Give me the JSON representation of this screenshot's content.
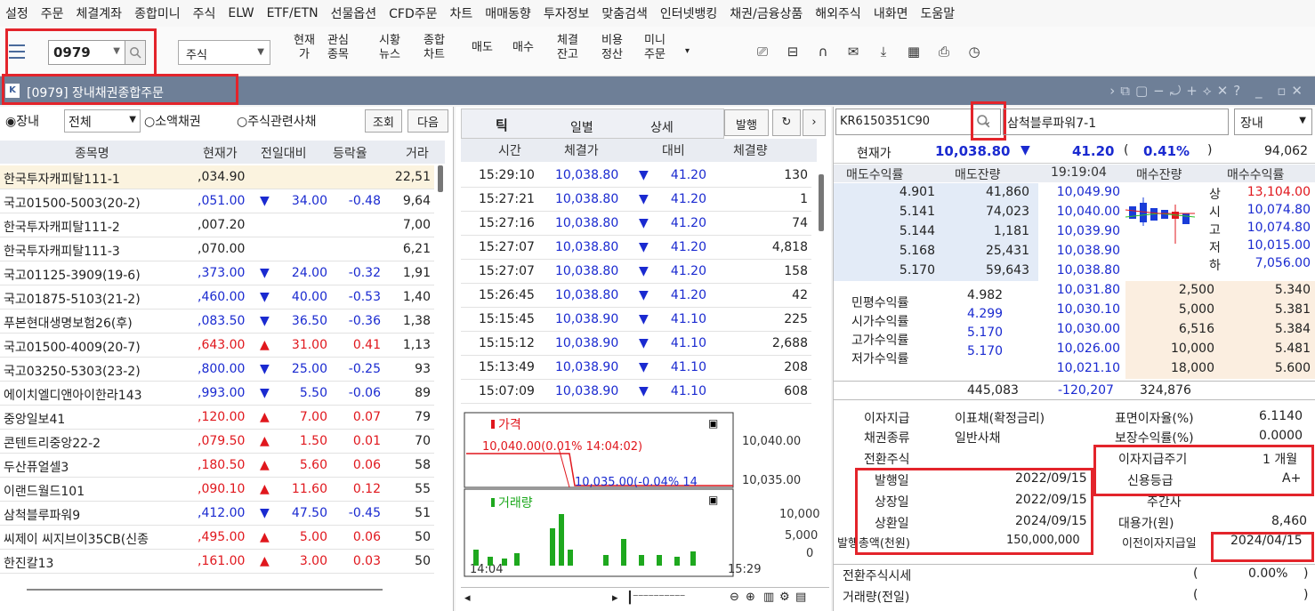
{
  "menu": [
    "설정",
    "주문",
    "체결계좌",
    "종합미니",
    "주식",
    "ELW",
    "ETF/ETN",
    "선물옵션",
    "CFD주문",
    "차트",
    "매매동향",
    "투자정보",
    "맞춤검색",
    "인터넷뱅킹",
    "채권/금융상품",
    "해외주식",
    "내화면",
    "도움말"
  ],
  "toolbar": {
    "code": "0979",
    "market_select": "주식",
    "buttons": [
      "현재\n가",
      "관심\n종목",
      "시황\n뉴스",
      "종합\n차트",
      "매도",
      "매수",
      "체결\n잔고",
      "비용\n정산",
      "미니\n주문"
    ],
    "icons": [
      "monitor-icon",
      "screen-icon",
      "headset-icon",
      "mail-icon",
      "download-icon",
      "calculator-icon",
      "print-icon",
      "clock-icon"
    ]
  },
  "window": {
    "title": "[0979] 장내채권종합주문"
  },
  "left": {
    "radio_listed": "장내",
    "filter": "전체",
    "radio_small": "소액채권",
    "radio_equity": "주식관련사채",
    "btn_query": "조회",
    "btn_next": "다음",
    "headers": [
      "종목명",
      "현재가",
      "전일대비",
      "등락율",
      "거라"
    ],
    "rows": [
      {
        "name": "한국투자캐피탈111-1",
        "price": ",034.90",
        "arrow": "",
        "change": "",
        "rate": "",
        "vol": "22,51",
        "dir": ""
      },
      {
        "name": "국고01500-5003(20-2)",
        "price": ",051.00",
        "arrow": "▼",
        "change": "34.00",
        "rate": "-0.48",
        "vol": "9,64",
        "dir": "down"
      },
      {
        "name": "한국투자캐피탈111-2",
        "price": ",007.20",
        "arrow": "",
        "change": "",
        "rate": "",
        "vol": "7,00",
        "dir": ""
      },
      {
        "name": "한국투자캐피탈111-3",
        "price": ",070.00",
        "arrow": "",
        "change": "",
        "rate": "",
        "vol": "6,21",
        "dir": ""
      },
      {
        "name": "국고01125-3909(19-6)",
        "price": ",373.00",
        "arrow": "▼",
        "change": "24.00",
        "rate": "-0.32",
        "vol": "1,91",
        "dir": "down"
      },
      {
        "name": "국고01875-5103(21-2)",
        "price": ",460.00",
        "arrow": "▼",
        "change": "40.00",
        "rate": "-0.53",
        "vol": "1,40",
        "dir": "down"
      },
      {
        "name": "푸본현대생명보험26(후)",
        "price": ",083.50",
        "arrow": "▼",
        "change": "36.50",
        "rate": "-0.36",
        "vol": "1,38",
        "dir": "down"
      },
      {
        "name": "국고01500-4009(20-7)",
        "price": ",643.00",
        "arrow": "▲",
        "change": "31.00",
        "rate": "0.41",
        "vol": "1,13",
        "dir": "up"
      },
      {
        "name": "국고03250-5303(23-2)",
        "price": ",800.00",
        "arrow": "▼",
        "change": "25.00",
        "rate": "-0.25",
        "vol": "93",
        "dir": "down"
      },
      {
        "name": "에이치엘디앤아이한라143",
        "price": ",993.00",
        "arrow": "▼",
        "change": "5.50",
        "rate": "-0.06",
        "vol": "89",
        "dir": "down"
      },
      {
        "name": "중앙일보41",
        "price": ",120.00",
        "arrow": "▲",
        "change": "7.00",
        "rate": "0.07",
        "vol": "79",
        "dir": "up"
      },
      {
        "name": "콘텐트리중앙22-2",
        "price": ",079.50",
        "arrow": "▲",
        "change": "1.50",
        "rate": "0.01",
        "vol": "70",
        "dir": "up"
      },
      {
        "name": "두산퓨얼셀3",
        "price": ",180.50",
        "arrow": "▲",
        "change": "5.60",
        "rate": "0.06",
        "vol": "58",
        "dir": "up"
      },
      {
        "name": "이랜드월드101",
        "price": ",090.10",
        "arrow": "▲",
        "change": "11.60",
        "rate": "0.12",
        "vol": "55",
        "dir": "up"
      },
      {
        "name": "삼척블루파워9",
        "price": ",412.00",
        "arrow": "▼",
        "change": "47.50",
        "rate": "-0.45",
        "vol": "51",
        "dir": "down"
      },
      {
        "name": "씨제이 씨지브이35CB(신종",
        "price": ",495.00",
        "arrow": "▲",
        "change": "5.00",
        "rate": "0.06",
        "vol": "50",
        "dir": "up"
      },
      {
        "name": "한진칼13",
        "price": ",161.00",
        "arrow": "▲",
        "change": "3.00",
        "rate": "0.03",
        "vol": "50",
        "dir": "up"
      }
    ]
  },
  "middle": {
    "tabs": [
      "틱",
      "일별",
      "상세"
    ],
    "btn_issue": "발행",
    "headers": [
      "시간",
      "체결가",
      "대비",
      "체결량"
    ],
    "rows": [
      {
        "time": "15:29:10",
        "price": "10,038.80",
        "change": "41.20",
        "qty": "130"
      },
      {
        "time": "15:27:21",
        "price": "10,038.80",
        "change": "41.20",
        "qty": "1"
      },
      {
        "time": "15:27:16",
        "price": "10,038.80",
        "change": "41.20",
        "qty": "74"
      },
      {
        "time": "15:27:07",
        "price": "10,038.80",
        "change": "41.20",
        "qty": "4,818"
      },
      {
        "time": "15:27:07",
        "price": "10,038.80",
        "change": "41.20",
        "qty": "158"
      },
      {
        "time": "15:26:45",
        "price": "10,038.80",
        "change": "41.20",
        "qty": "42"
      },
      {
        "time": "15:15:45",
        "price": "10,038.90",
        "change": "41.10",
        "qty": "225"
      },
      {
        "time": "15:15:12",
        "price": "10,038.90",
        "change": "41.10",
        "qty": "2,688"
      },
      {
        "time": "15:13:49",
        "price": "10,038.90",
        "change": "41.10",
        "qty": "208"
      },
      {
        "time": "15:07:09",
        "price": "10,038.90",
        "change": "41.10",
        "qty": "608"
      }
    ],
    "chart": {
      "price_label": "가격",
      "vol_label": "거래량",
      "annot_high": "10,040.00(0.01% 14:04:02)",
      "annot_low": "10,035.00(-0.04% 14",
      "y_price": [
        "10,040.00",
        "10,035.00"
      ],
      "y_vol": [
        "10,000",
        "5,000",
        "0"
      ],
      "x_start": "14:04",
      "x_end": "15:29"
    }
  },
  "right": {
    "isin": "KR6150351C90",
    "bond_name": "삼척블루파워7-1",
    "market": "장내",
    "cur_label": "현재가",
    "cur_price": "10,038.80",
    "cur_change": "41.20",
    "cur_rate": "0.41%",
    "cur_vol": "94,062",
    "ob_headers": [
      "매도수익률",
      "매도잔량",
      "19:19:04",
      "매수잔량",
      "매수수익률"
    ],
    "asks": [
      {
        "yield": "4.901",
        "qty": "41,860",
        "price": "10,049.90"
      },
      {
        "yield": "5.141",
        "qty": "74,023",
        "price": "10,040.00"
      },
      {
        "yield": "5.144",
        "qty": "1,181",
        "price": "10,039.90"
      },
      {
        "yield": "5.168",
        "qty": "25,431",
        "price": "10,038.90"
      },
      {
        "yield": "5.170",
        "qty": "59,643",
        "price": "10,038.80"
      }
    ],
    "limits": [
      {
        "k": "상",
        "v": "13,104.00",
        "c": "red"
      },
      {
        "k": "시",
        "v": "10,074.80",
        "c": "blue"
      },
      {
        "k": "고",
        "v": "10,074.80",
        "c": "blue"
      },
      {
        "k": "저",
        "v": "10,015.00",
        "c": "blue"
      },
      {
        "k": "하",
        "v": "7,056.00",
        "c": "blue"
      }
    ],
    "bids": [
      {
        "price": "10,031.80",
        "qty": "2,500",
        "yield": "5.340"
      },
      {
        "price": "10,030.10",
        "qty": "5,000",
        "yield": "5.381"
      },
      {
        "price": "10,030.00",
        "qty": "6,516",
        "yield": "5.384"
      },
      {
        "price": "10,026.00",
        "qty": "10,000",
        "yield": "5.481"
      },
      {
        "price": "10,021.10",
        "qty": "18,000",
        "yield": "5.600"
      }
    ],
    "yields": [
      {
        "k": "민평수익률",
        "v": "4.982"
      },
      {
        "k": "시가수익률",
        "v": "4.299"
      },
      {
        "k": "고가수익률",
        "v": "5.170"
      },
      {
        "k": "저가수익률",
        "v": "5.170"
      }
    ],
    "totals": {
      "ask": "445,083",
      "diff": "-120,207",
      "bid": "324,876"
    },
    "info": {
      "interest_pay_label": "이자지급",
      "interest_pay": "이표채(확정금리)",
      "coupon_label": "표면이자율(%)",
      "coupon": "6.1140",
      "bond_type_label": "채권종류",
      "bond_type": "일반사채",
      "guarantee_label": "보장수익률(%)",
      "guarantee": "0.0000",
      "conv_label": "전환주식",
      "period_label": "이자지급주기",
      "period": "1 개월",
      "issue_label": "발행일",
      "issue": "2022/09/15",
      "credit_label": "신용등급",
      "credit": "A+",
      "listing_label": "상장일",
      "listing": "2022/09/15",
      "manager_label": "주간사",
      "maturity_label": "상환일",
      "maturity": "2024/09/15",
      "sub_label": "대용가(원)",
      "sub": "8,460",
      "issue_amt_label": "발행총액(천원)",
      "issue_amt": "150,000,000",
      "prev_pay_label": "이전이자지급일",
      "prev_pay": "2024/04/15",
      "conv_price_label": "전환주식시세",
      "conv_pct": "0.00%",
      "vol_prev_label": "거래량(전일)"
    }
  }
}
